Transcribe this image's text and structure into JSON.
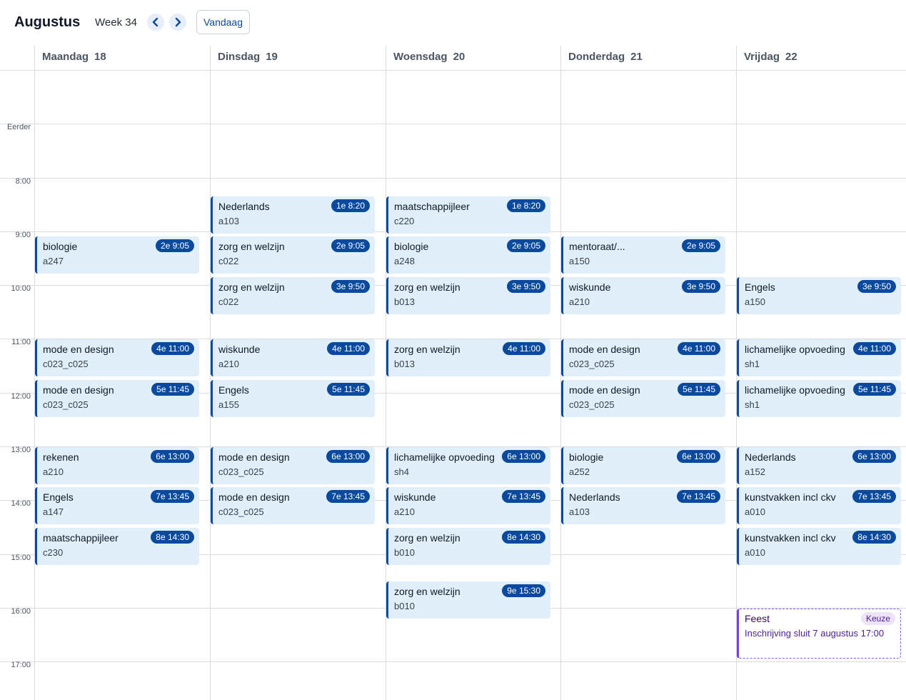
{
  "header": {
    "month": "Augustus",
    "week": "Week 34",
    "today_label": "Vandaag",
    "prev_icon": "chevron-left-icon",
    "next_icon": "chevron-right-icon"
  },
  "days": [
    {
      "name": "Maandag",
      "num": "18"
    },
    {
      "name": "Dinsdag",
      "num": "19"
    },
    {
      "name": "Woensdag",
      "num": "20"
    },
    {
      "name": "Donderdag",
      "num": "21"
    },
    {
      "name": "Vrijdag",
      "num": "22"
    }
  ],
  "times": [
    "Eerder",
    "8:00",
    "9:00",
    "10:00",
    "11:00",
    "12:00",
    "13:00",
    "14:00",
    "15:00",
    "16:00",
    "17:00"
  ],
  "events": [
    {
      "day": 0,
      "subject": "biologie",
      "room": "a247",
      "badge": "2e 9:05",
      "start": "9:05"
    },
    {
      "day": 0,
      "subject": "mode en design",
      "room": "c023_c025",
      "badge": "4e 11:00",
      "start": "11:00"
    },
    {
      "day": 0,
      "subject": "mode en design",
      "room": "c023_c025",
      "badge": "5e 11:45",
      "start": "11:45"
    },
    {
      "day": 0,
      "subject": "rekenen",
      "room": "a210",
      "badge": "6e 13:00",
      "start": "13:00"
    },
    {
      "day": 0,
      "subject": "Engels",
      "room": "a147",
      "badge": "7e 13:45",
      "start": "13:45"
    },
    {
      "day": 0,
      "subject": "maatschappijleer",
      "room": "c230",
      "badge": "8e 14:30",
      "start": "14:30"
    },
    {
      "day": 1,
      "subject": "Nederlands",
      "room": "a103",
      "badge": "1e 8:20",
      "start": "8:20"
    },
    {
      "day": 1,
      "subject": "zorg en welzijn",
      "room": "c022",
      "badge": "2e 9:05",
      "start": "9:05"
    },
    {
      "day": 1,
      "subject": "zorg en welzijn",
      "room": "c022",
      "badge": "3e 9:50",
      "start": "9:50"
    },
    {
      "day": 1,
      "subject": "wiskunde",
      "room": "a210",
      "badge": "4e 11:00",
      "start": "11:00"
    },
    {
      "day": 1,
      "subject": "Engels",
      "room": "a155",
      "badge": "5e 11:45",
      "start": "11:45"
    },
    {
      "day": 1,
      "subject": "mode en design",
      "room": "c023_c025",
      "badge": "6e 13:00",
      "start": "13:00"
    },
    {
      "day": 1,
      "subject": "mode en design",
      "room": "c023_c025",
      "badge": "7e 13:45",
      "start": "13:45"
    },
    {
      "day": 2,
      "subject": "maatschappijleer",
      "room": "c220",
      "badge": "1e 8:20",
      "start": "8:20"
    },
    {
      "day": 2,
      "subject": "biologie",
      "room": "a248",
      "badge": "2e 9:05",
      "start": "9:05"
    },
    {
      "day": 2,
      "subject": "zorg en welzijn",
      "room": "b013",
      "badge": "3e 9:50",
      "start": "9:50"
    },
    {
      "day": 2,
      "subject": "zorg en welzijn",
      "room": "b013",
      "badge": "4e 11:00",
      "start": "11:00"
    },
    {
      "day": 2,
      "subject": "lichamelijke opvoeding",
      "room": "sh4",
      "badge": "6e 13:00",
      "start": "13:00"
    },
    {
      "day": 2,
      "subject": "wiskunde",
      "room": "a210",
      "badge": "7e 13:45",
      "start": "13:45"
    },
    {
      "day": 2,
      "subject": "zorg en welzijn",
      "room": "b010",
      "badge": "8e 14:30",
      "start": "14:30"
    },
    {
      "day": 2,
      "subject": "zorg en welzijn",
      "room": "b010",
      "badge": "9e 15:30",
      "start": "15:30"
    },
    {
      "day": 3,
      "subject": "mentoraat/...",
      "room": "a150",
      "badge": "2e 9:05",
      "start": "9:05"
    },
    {
      "day": 3,
      "subject": "wiskunde",
      "room": "a210",
      "badge": "3e 9:50",
      "start": "9:50"
    },
    {
      "day": 3,
      "subject": "mode en design",
      "room": "c023_c025",
      "badge": "4e 11:00",
      "start": "11:00"
    },
    {
      "day": 3,
      "subject": "mode en design",
      "room": "c023_c025",
      "badge": "5e 11:45",
      "start": "11:45"
    },
    {
      "day": 3,
      "subject": "biologie",
      "room": "a252",
      "badge": "6e 13:00",
      "start": "13:00"
    },
    {
      "day": 3,
      "subject": "Nederlands",
      "room": "a103",
      "badge": "7e 13:45",
      "start": "13:45"
    },
    {
      "day": 4,
      "subject": "Engels",
      "room": "a150",
      "badge": "3e 9:50",
      "start": "9:50"
    },
    {
      "day": 4,
      "subject": "lichamelijke opvoeding",
      "room": "sh1",
      "badge": "4e 11:00",
      "start": "11:00"
    },
    {
      "day": 4,
      "subject": "lichamelijke opvoeding",
      "room": "sh1",
      "badge": "5e 11:45",
      "start": "11:45"
    },
    {
      "day": 4,
      "subject": "Nederlands",
      "room": "a152",
      "badge": "6e 13:00",
      "start": "13:00"
    },
    {
      "day": 4,
      "subject": "kunstvakken incl ckv",
      "room": "a010",
      "badge": "7e 13:45",
      "start": "13:45"
    },
    {
      "day": 4,
      "subject": "kunstvakken incl ckv",
      "room": "a010",
      "badge": "8e 14:30",
      "start": "14:30"
    },
    {
      "day": 4,
      "subject": "Feest",
      "room": "Inschrijving sluit 7 augustus 17:00",
      "badge": "Keuze",
      "start": "16:00",
      "type": "keuze"
    }
  ],
  "colors": {
    "accent": "#0a4a9e",
    "event_bg": "#e1effa",
    "keuze_border": "#7c3aed"
  }
}
